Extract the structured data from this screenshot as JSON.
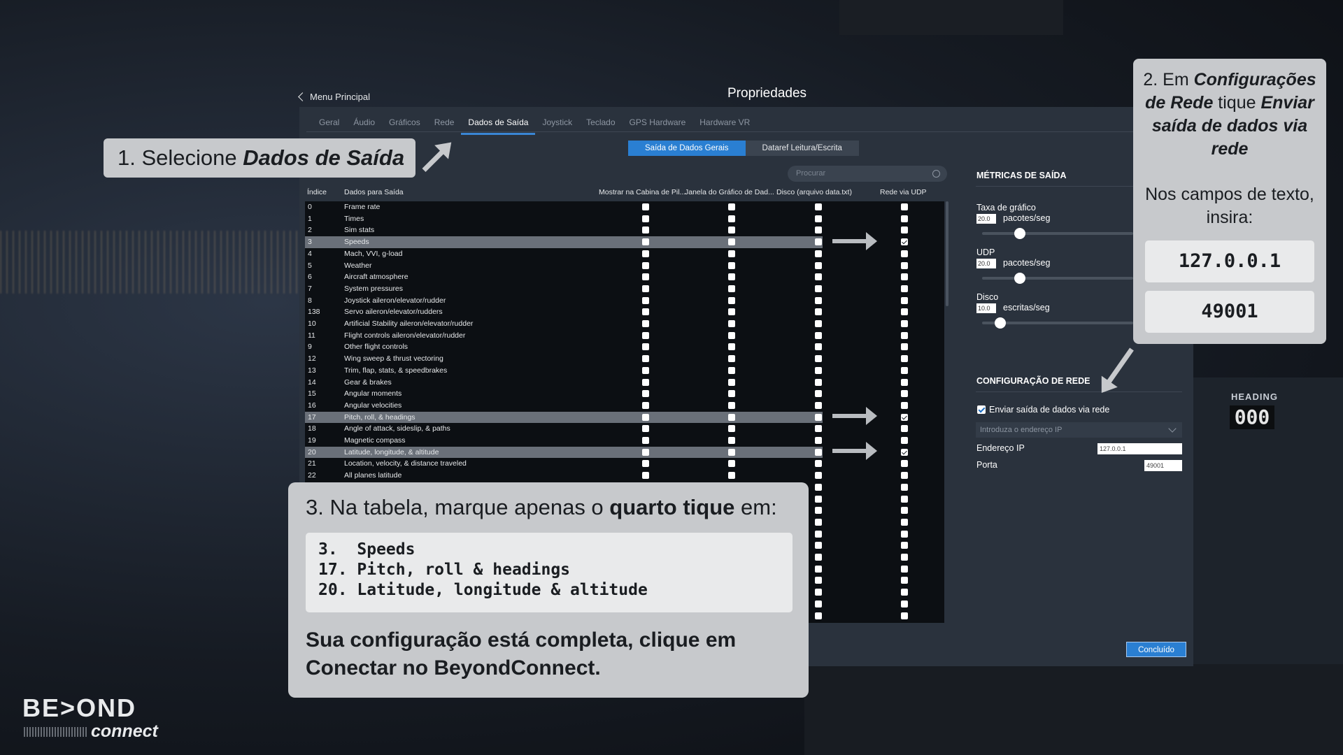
{
  "window": {
    "back_label": "Menu Principal",
    "title": "Propriedades"
  },
  "tabs": [
    "Geral",
    "Áudio",
    "Gráficos",
    "Rede",
    "Dados de Saída",
    "Joystick",
    "Teclado",
    "GPS Hardware",
    "Hardware VR"
  ],
  "active_tab": "Dados de Saída",
  "subtabs": [
    "Saída de Dados Gerais",
    "Dataref Leitura/Escrita"
  ],
  "search": {
    "placeholder": "Procurar"
  },
  "table": {
    "headers": [
      "Índice",
      "Dados para Saída",
      "Mostrar na Cabina de Pil...",
      "Janela do Gráfico de Dad...",
      "Disco (arquivo data.txt)",
      "Rede via UDP"
    ],
    "rows": [
      {
        "index": "0",
        "name": "Frame rate",
        "udp": false
      },
      {
        "index": "1",
        "name": "Times",
        "udp": false
      },
      {
        "index": "2",
        "name": "Sim stats",
        "udp": false
      },
      {
        "index": "3",
        "name": "Speeds",
        "udp": true,
        "highlight": true
      },
      {
        "index": "4",
        "name": "Mach, VVI, g-load",
        "udp": false
      },
      {
        "index": "5",
        "name": "Weather",
        "udp": false
      },
      {
        "index": "6",
        "name": "Aircraft atmosphere",
        "udp": false
      },
      {
        "index": "7",
        "name": "System pressures",
        "udp": false
      },
      {
        "index": "8",
        "name": "Joystick aileron/elevator/rudder",
        "udp": false
      },
      {
        "index": "138",
        "name": "Servo aileron/elevator/rudders",
        "udp": false
      },
      {
        "index": "10",
        "name": "Artificial Stability aileron/elevator/rudder",
        "udp": false
      },
      {
        "index": "11",
        "name": "Flight controls aileron/elevator/rudder",
        "udp": false
      },
      {
        "index": "9",
        "name": "Other flight controls",
        "udp": false
      },
      {
        "index": "12",
        "name": "Wing sweep & thrust vectoring",
        "udp": false
      },
      {
        "index": "13",
        "name": "Trim, flap, stats, & speedbrakes",
        "udp": false
      },
      {
        "index": "14",
        "name": "Gear & brakes",
        "udp": false
      },
      {
        "index": "15",
        "name": "Angular moments",
        "udp": false
      },
      {
        "index": "16",
        "name": "Angular velocities",
        "udp": false
      },
      {
        "index": "17",
        "name": "Pitch, roll, & headings",
        "udp": true,
        "highlight": true
      },
      {
        "index": "18",
        "name": "Angle of attack, sideslip, & paths",
        "udp": false
      },
      {
        "index": "19",
        "name": "Magnetic compass",
        "udp": false
      },
      {
        "index": "20",
        "name": "Latitude, longitude, & altitude",
        "udp": true,
        "highlight": true
      },
      {
        "index": "21",
        "name": "Location, velocity, & distance traveled",
        "udp": false
      },
      {
        "index": "22",
        "name": "All planes latitude",
        "udp": false
      }
    ]
  },
  "metrics": {
    "title": "MÉTRICAS DE SAÍDA",
    "items": [
      {
        "label": "Taxa de gráfico",
        "value": "20.0",
        "unit": "pacotes/seg",
        "level": 0.25
      },
      {
        "label": "UDP",
        "value": "20.0",
        "unit": "pacotes/seg",
        "level": 0.25
      },
      {
        "label": "Disco",
        "value": "10.0",
        "unit": "escritas/seg",
        "level": 0.12
      }
    ]
  },
  "network": {
    "title": "CONFIGURAÇÃO DE REDE",
    "checkbox_label": "Enviar saída de dados via rede",
    "checked": true,
    "ip_select_placeholder": "Introduza o endereço IP",
    "ip_label": "Endereço IP",
    "ip_value": "127.0.0.1",
    "port_label": "Porta",
    "port_value": "49001"
  },
  "done_button": "Concluído",
  "callouts": {
    "step1_prefix": "1. Selecione ",
    "step1_bold": "Dados de Saída",
    "step2_a": "2. Em ",
    "step2_b": "Configurações de Rede",
    "step2_c": " tique ",
    "step2_d": "Enviar saída de dados via rede",
    "step2_fields": "Nos campos de texto, insira:",
    "step2_ip": "127.0.0.1",
    "step2_port": "49001",
    "step3_a": "3. Na tabela, marque apenas o ",
    "step3_b": "quarto tique",
    "step3_c": " em:",
    "step3_items": [
      "3.  Speeds",
      "17. Pitch, roll & headings",
      "20. Latitude, longitude & altitude"
    ],
    "step3_footer": "Sua configuração está completa, clique em Conectar no BeyondConnect."
  },
  "logo": {
    "brand": "BE>OND",
    "sub": "connect"
  },
  "background": {
    "heading_label": "HEADING",
    "heading_value": "000"
  }
}
